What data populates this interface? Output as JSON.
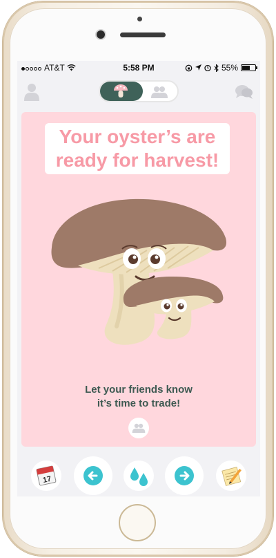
{
  "status_bar": {
    "carrier": "AT&T",
    "time": "5:58 PM",
    "battery": "55%",
    "battery_level": 0.55
  },
  "top_nav": {
    "left_icon": "profile-icon",
    "right_icon": "chat-icon",
    "toggle_active": "mushroom-icon",
    "toggle_inactive": "friends-icon",
    "toggle_color": "#3f6259"
  },
  "card": {
    "title": "Your oyster’s are ready for harvest!",
    "message_line1": "Let your friends know",
    "message_line2": "it’s time to trade!",
    "background": "#ffd7dd",
    "title_color": "#f79aa6",
    "text_color": "#3e5a52"
  },
  "toolbar": {
    "calendar_day": "17",
    "items": [
      "calendar-icon",
      "previous-arrow-icon",
      "water-drop-icon",
      "next-arrow-icon",
      "notes-icon"
    ],
    "accent": "#3cc3cf"
  }
}
